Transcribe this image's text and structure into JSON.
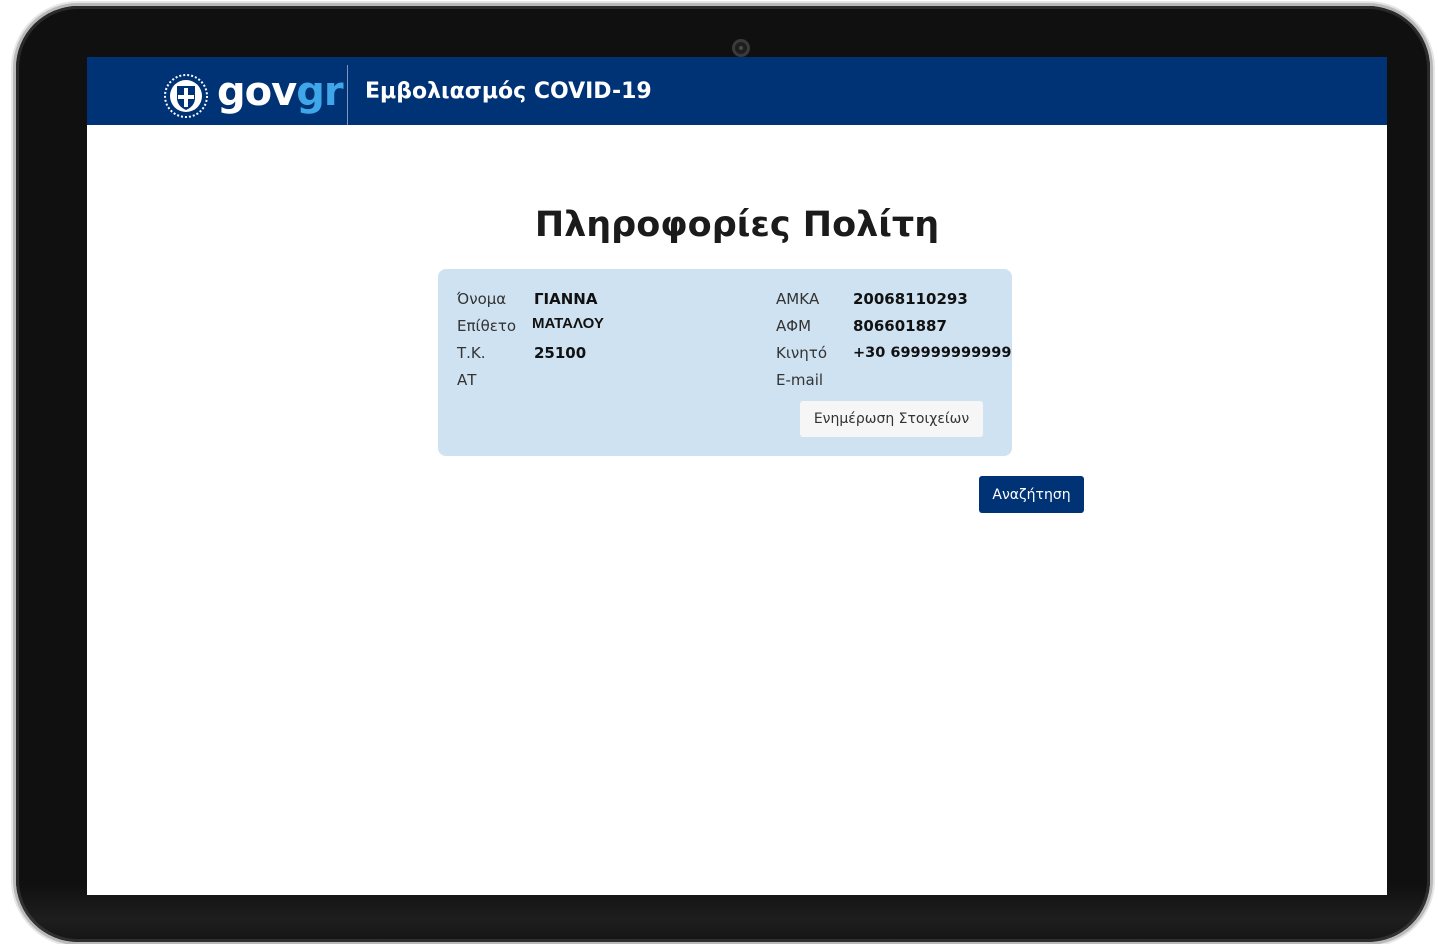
{
  "header": {
    "logo_gov": "gov",
    "logo_gr": "gr",
    "app_title": "Εμβολιασμός COVID-19",
    "background": "#003375"
  },
  "page": {
    "title": "Πληροφορίες Πολίτη"
  },
  "citizen": {
    "left": [
      {
        "label": "Όνομα",
        "value": "ΓΙΑΝΝΑ"
      },
      {
        "label": "Επίθετο",
        "value": "ΜΑΤΑΛΟΥ"
      },
      {
        "label": "Τ.Κ.",
        "value": "25100"
      },
      {
        "label": "ΑΤ",
        "value": ""
      }
    ],
    "right": [
      {
        "label": "ΑΜΚΑ",
        "value": "20068110293"
      },
      {
        "label": "ΑΦΜ",
        "value": "806601887"
      },
      {
        "label": "Κινητό",
        "value": "+30 699999999999"
      },
      {
        "label": "E-mail",
        "value": ""
      }
    ],
    "update_button": "Ενημέρωση Στοιχείων",
    "card_color": "#cfe2f2"
  },
  "actions": {
    "search_button": "Αναζήτηση"
  },
  "icons": {
    "emblem": "greek-coat-of-arms-icon"
  }
}
